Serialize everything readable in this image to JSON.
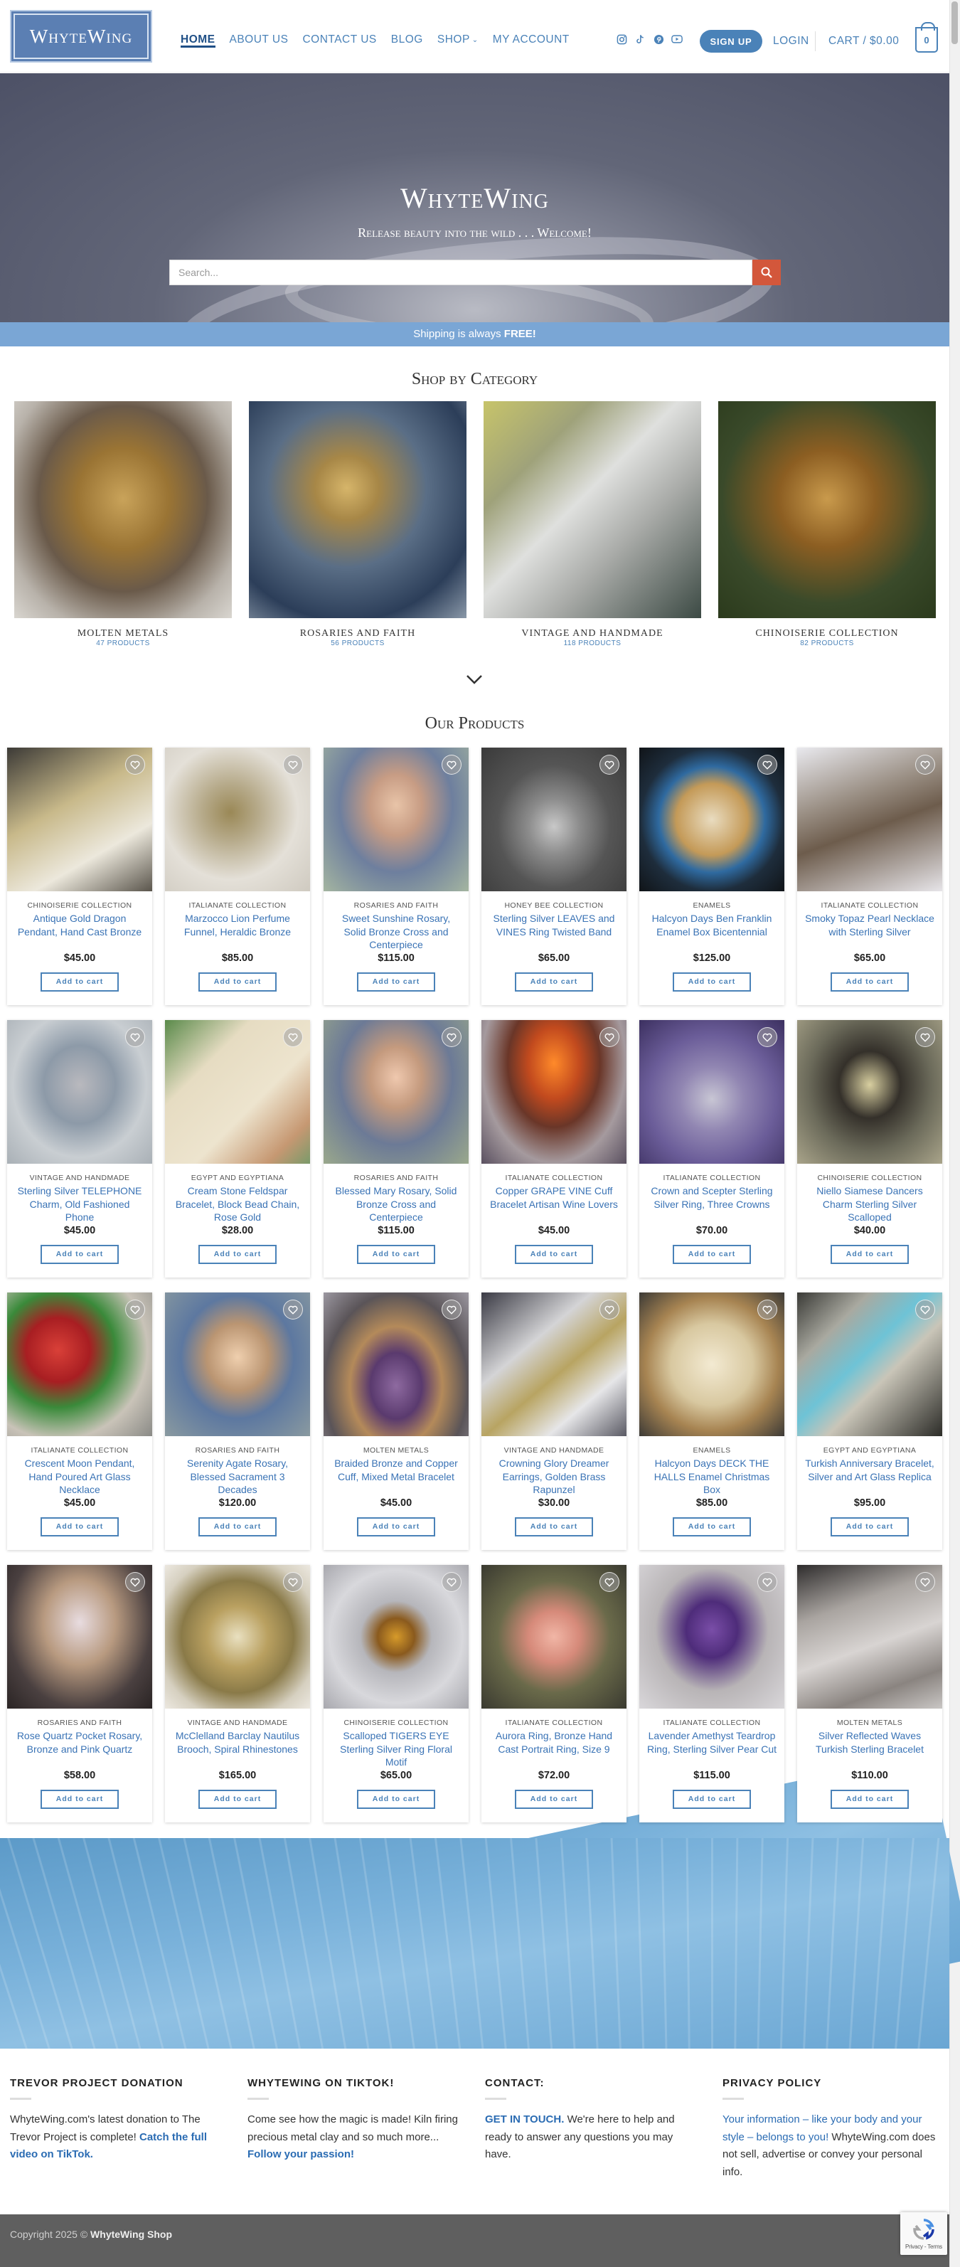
{
  "header": {
    "logo_text": "WhyteWing",
    "nav": [
      {
        "label": "Home",
        "active": true
      },
      {
        "label": "About Us"
      },
      {
        "label": "Contact Us"
      },
      {
        "label": "Blog"
      },
      {
        "label": "Shop",
        "has_dropdown": true
      },
      {
        "label": "My Account"
      }
    ],
    "social_icons": [
      "instagram-icon",
      "tiktok-icon",
      "pinterest-icon",
      "youtube-icon"
    ],
    "signup_label": "Sign Up",
    "login_label": "Login",
    "cart_label": "Cart / $0.00",
    "cart_count": "0"
  },
  "hero": {
    "title": "WhyteWing",
    "subtitle": "Release beauty into the wild . . . Welcome!",
    "search_placeholder": "Search..."
  },
  "shipping_banner": {
    "text": "Shipping is always ",
    "bold": "FREE!"
  },
  "categories": {
    "title": "Shop by Category",
    "items": [
      {
        "name": "Molten Metals",
        "count": "47 Products"
      },
      {
        "name": "Rosaries and Faith",
        "count": "56 Products"
      },
      {
        "name": "Vintage and Handmade",
        "count": "118 Products"
      },
      {
        "name": "Chinoiserie Collection",
        "count": "82 Products"
      }
    ]
  },
  "products": {
    "title": "Our Products",
    "add_to_cart_label": "Add to cart",
    "items": [
      {
        "category": "Chinoiserie Collection",
        "name": "Antique Gold Dragon Pendant, Hand Cast Bronze",
        "price": "$45.00"
      },
      {
        "category": "Italianate Collection",
        "name": "Marzocco Lion Perfume Funnel, Heraldic Bronze",
        "price": "$85.00"
      },
      {
        "category": "Rosaries and Faith",
        "name": "Sweet Sunshine Rosary, Solid Bronze Cross and Centerpiece",
        "price": "$115.00"
      },
      {
        "category": "Honey Bee Collection",
        "name": "Sterling Silver LEAVES and VINES Ring Twisted Band",
        "price": "$65.00"
      },
      {
        "category": "Enamels",
        "name": "Halcyon Days Ben Franklin Enamel Box Bicentennial",
        "price": "$125.00"
      },
      {
        "category": "Italianate Collection",
        "name": "Smoky Topaz Pearl Necklace with Sterling Silver",
        "price": "$65.00"
      },
      {
        "category": "Vintage and Handmade",
        "name": "Sterling Silver TELEPHONE Charm, Old Fashioned Phone",
        "price": "$45.00"
      },
      {
        "category": "Egypt and Egyptiana",
        "name": "Cream Stone Feldspar Bracelet, Block Bead Chain, Rose Gold",
        "price": "$28.00"
      },
      {
        "category": "Rosaries and Faith",
        "name": "Blessed Mary Rosary, Solid Bronze Cross and Centerpiece",
        "price": "$115.00"
      },
      {
        "category": "Italianate Collection",
        "name": "Copper GRAPE VINE Cuff Bracelet Artisan Wine Lovers",
        "price": "$45.00"
      },
      {
        "category": "Italianate Collection",
        "name": "Crown and Scepter Sterling Silver Ring, Three Crowns",
        "price": "$70.00"
      },
      {
        "category": "Chinoiserie Collection",
        "name": "Niello Siamese Dancers Charm Sterling Silver Scalloped",
        "price": "$40.00"
      },
      {
        "category": "Italianate Collection",
        "name": "Crescent Moon Pendant, Hand Poured Art Glass Necklace",
        "price": "$45.00"
      },
      {
        "category": "Rosaries and Faith",
        "name": "Serenity Agate Rosary, Blessed Sacrament 3 Decades",
        "price": "$120.00"
      },
      {
        "category": "Molten Metals",
        "name": "Braided Bronze and Copper Cuff, Mixed Metal Bracelet",
        "price": "$45.00"
      },
      {
        "category": "Vintage and Handmade",
        "name": "Crowning Glory Dreamer Earrings, Golden Brass Rapunzel",
        "price": "$30.00"
      },
      {
        "category": "Enamels",
        "name": "Halcyon Days DECK THE HALLS Enamel Christmas Box",
        "price": "$85.00"
      },
      {
        "category": "Egypt and Egyptiana",
        "name": "Turkish Anniversary Bracelet, Silver and Art Glass Replica",
        "price": "$95.00"
      },
      {
        "category": "Rosaries and Faith",
        "name": "Rose Quartz Pocket Rosary, Bronze and Pink Quartz",
        "price": "$58.00"
      },
      {
        "category": "Vintage and Handmade",
        "name": "McClelland Barclay Nautilus Brooch, Spiral Rhinestones",
        "price": "$165.00"
      },
      {
        "category": "Chinoiserie Collection",
        "name": "Scalloped TIGERS EYE Sterling Silver Ring Floral Motif",
        "price": "$65.00"
      },
      {
        "category": "Italianate Collection",
        "name": "Aurora Ring, Bronze Hand Cast Portrait Ring, Size 9",
        "price": "$72.00"
      },
      {
        "category": "Italianate Collection",
        "name": "Lavender Amethyst Teardrop Ring, Sterling Silver Pear Cut",
        "price": "$115.00"
      },
      {
        "category": "Molten Metals",
        "name": "Silver Reflected Waves Turkish Sterling Bracelet",
        "price": "$110.00"
      }
    ]
  },
  "footer": {
    "widgets": [
      {
        "title": "Trevor Project Donation",
        "text": "WhyteWing.com's latest donation to The Trevor Project is complete! ",
        "link": "Catch the full video on TikTok."
      },
      {
        "title": "WhyteWing on TikTok!",
        "text": "Come see how the magic is made!  Kiln firing precious metal clay and so much more... ",
        "link": "Follow your passion!"
      },
      {
        "title": "Contact:",
        "link": "GET IN TOUCH.",
        "text": " We're here to help and ready to answer any questions you may have."
      },
      {
        "title": "Privacy Policy",
        "link": "Your information – like your body and your style – belongs to you!",
        "text": " WhyteWing.com does not sell, advertise or convey your personal info."
      }
    ],
    "copyright_prefix": "Copyright 2025 © ",
    "copyright_brand": "WhyteWing Shop",
    "recaptcha_text": "Privacy - Terms"
  }
}
